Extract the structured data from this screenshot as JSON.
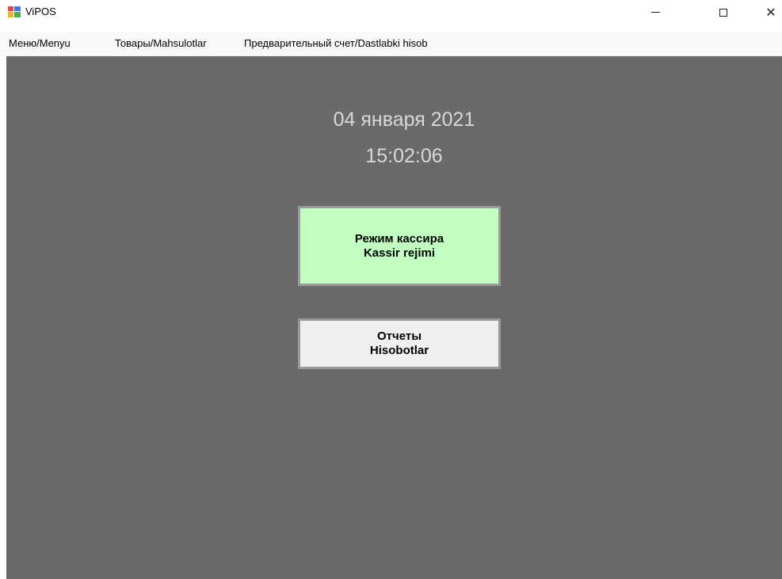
{
  "window": {
    "title": "ViPOS",
    "icon": "app-window-icon",
    "controls": {
      "minimize": "minimize-icon",
      "maximize": "maximize-icon",
      "close": "close-icon",
      "close_glyph": "✕"
    }
  },
  "menu": {
    "items": [
      {
        "label": "Меню/Menyu"
      },
      {
        "label": "Товары/Mahsulotlar"
      },
      {
        "label": "Предварительный счет/Dastlabki hisob"
      }
    ]
  },
  "main": {
    "date": "04 января 2021",
    "time": "15:02:06",
    "cashier_button": {
      "line1": "Режим кассира",
      "line2": "Kassir rejimi"
    },
    "reports_button": {
      "line1": "Отчеты",
      "line2": "Hisobotlar"
    }
  },
  "colors": {
    "background": "#6a6a6a",
    "cashier_button": "#c0ffc0",
    "reports_button": "#efefef",
    "clock_text": "#d8d8d8"
  }
}
